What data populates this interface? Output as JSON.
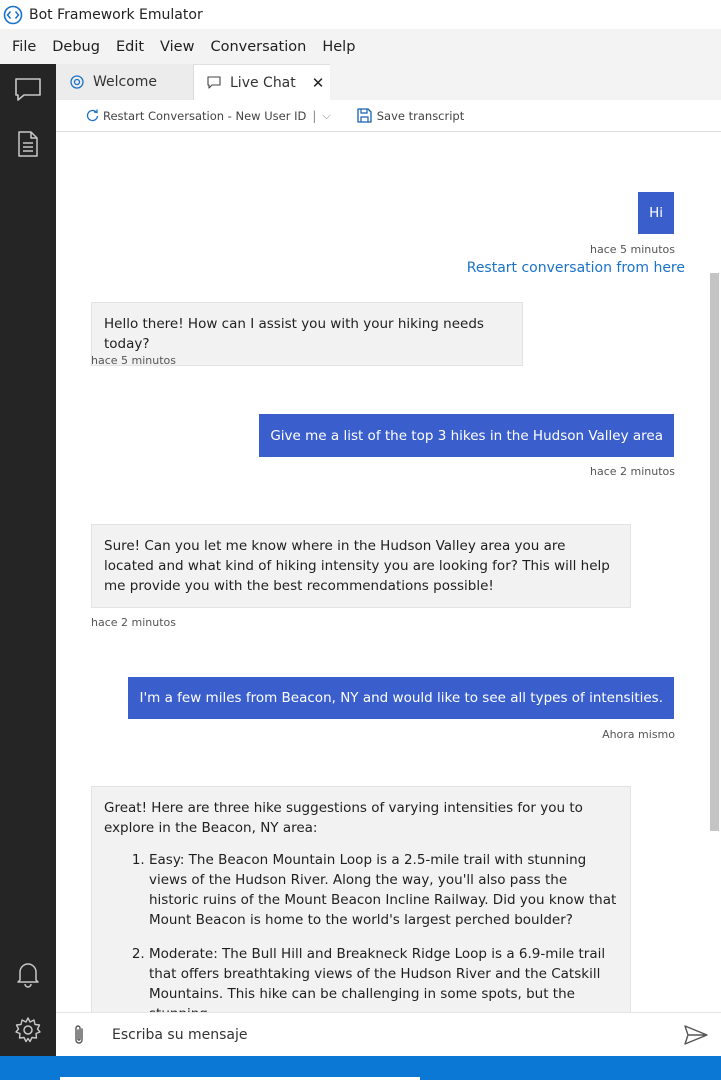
{
  "window": {
    "title": "Bot Framework Emulator"
  },
  "menu": [
    "File",
    "Debug",
    "Edit",
    "View",
    "Conversation",
    "Help"
  ],
  "tabs": [
    {
      "label": "Welcome",
      "icon": "emulator-icon"
    },
    {
      "label": "Live Chat",
      "icon": "chat-icon",
      "close": "✕"
    }
  ],
  "toolbar": {
    "restart_label": "Restart Conversation - New User ID",
    "save_label": "Save transcript"
  },
  "messages": [
    {
      "from": "user",
      "text": "Hi",
      "time": "hace 5 minutos"
    },
    {
      "restart_link": "Restart conversation from here"
    },
    {
      "from": "bot",
      "text": "Hello there! How can I assist you with your hiking needs today?",
      "time": "hace 5 minutos"
    },
    {
      "from": "user",
      "text": "Give me a list of the top 3 hikes in the Hudson Valley area",
      "time": "hace 2 minutos"
    },
    {
      "from": "bot",
      "text": "Sure! Can you let me know where in the Hudson Valley area you are located and what kind of hiking intensity you are looking for? This will help me provide you with the best recommendations possible!",
      "time": "hace 2 minutos"
    },
    {
      "from": "user",
      "text": "I'm a few miles from Beacon, NY and would like to see all types of intensities.",
      "time": "Ahora mismo"
    },
    {
      "from": "bot",
      "intro": "Great! Here are three hike suggestions of varying intensities for you to explore in the Beacon, NY area:",
      "items": [
        "Easy: The Beacon Mountain Loop is a 2.5-mile trail with stunning views of the Hudson River. Along the way, you'll also pass the historic ruins of the Mount Beacon Incline Railway. Did you know that Mount Beacon is home to the world's largest perched boulder?",
        "Moderate: The Bull Hill and Breakneck Ridge Loop is a 6.9-mile trail that offers breathtaking views of the Hudson River and the Catskill Mountains. This hike can be challenging in some spots, but the stunning"
      ]
    }
  ],
  "input": {
    "placeholder": "Escriba su mensaje"
  },
  "colors": {
    "user_bubble": "#3a5fcd",
    "link": "#1a73c8",
    "activity_bar": "#252526",
    "status_bar": "#0a78d4"
  }
}
